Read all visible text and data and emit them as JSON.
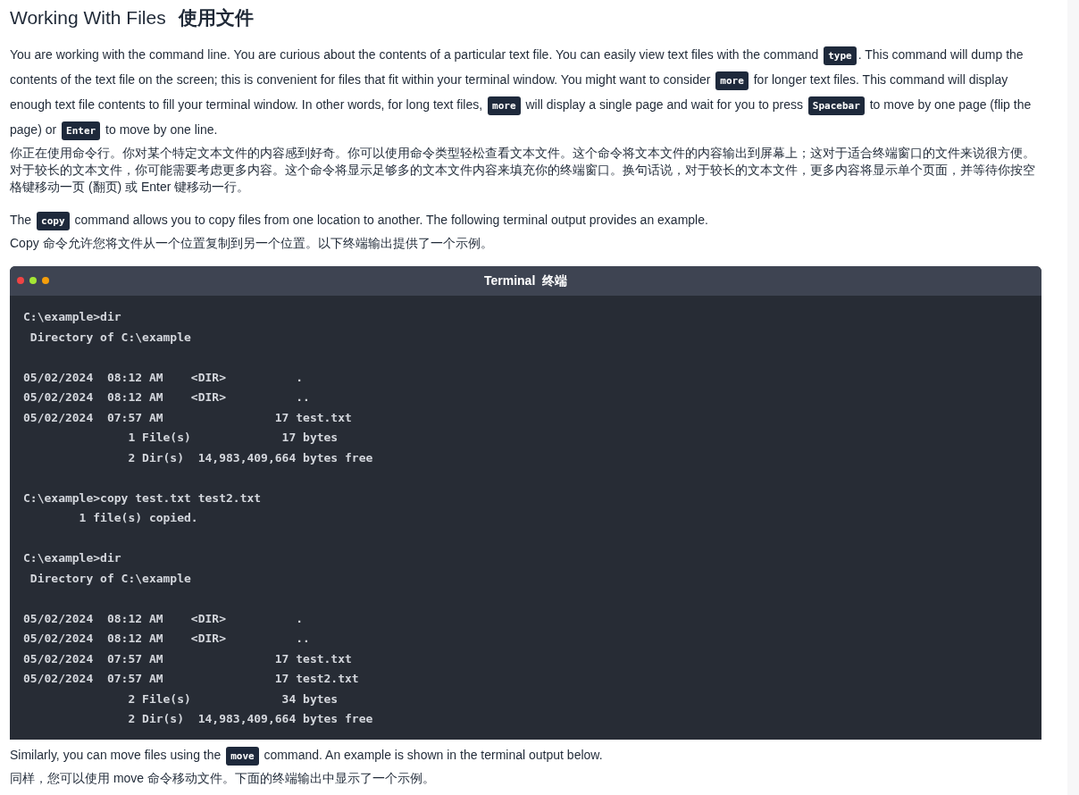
{
  "heading": {
    "english": "Working With Files",
    "chinese": "使用文件"
  },
  "sections": [
    {
      "english": [
        {
          "kind": "text",
          "text": "You are working with the command line. You are curious about the contents of a particular text file. You can easily view text files with the command "
        },
        {
          "kind": "code",
          "text": "type"
        },
        {
          "kind": "text",
          "text": ". This command will dump the contents of the text file on the screen; this is convenient for files that fit within your terminal window. You might want to consider "
        },
        {
          "kind": "code",
          "text": "more"
        },
        {
          "kind": "text",
          "text": " for longer text files. This command will display enough text file contents to fill your terminal window. In other words, for long text files, "
        },
        {
          "kind": "code",
          "text": "more"
        },
        {
          "kind": "text",
          "text": " will display a single page and wait for you to press "
        },
        {
          "kind": "code",
          "text": "Spacebar"
        },
        {
          "kind": "text",
          "text": " to move by one page (flip the page) or "
        },
        {
          "kind": "code",
          "text": "Enter"
        },
        {
          "kind": "text",
          "text": " to move by one line."
        }
      ],
      "chinese": "你正在使用命令行。你对某个特定文本文件的内容感到好奇。你可以使用命令类型轻松查看文本文件。这个命令将文本文件的内容输出到屏幕上；这对于适合终端窗口的文件来说很方便。对于较长的文本文件，你可能需要考虑更多内容。这个命令将显示足够多的文本文件内容来填充你的终端窗口。换句话说，对于较长的文本文件，更多内容将显示单个页面，并等待你按空格键移动一页 (翻页) 或 Enter 键移动一行。"
    },
    {
      "english": [
        {
          "kind": "text",
          "text": "The "
        },
        {
          "kind": "code",
          "text": "copy"
        },
        {
          "kind": "text",
          "text": " command allows you to copy files from one location to another. The following terminal output provides an example."
        }
      ],
      "chinese": "Copy 命令允许您将文件从一个位置复制到另一个位置。以下终端输出提供了一个示例。",
      "terminal": {
        "title": "Terminal  终端",
        "blocks": [
          [
            "C:\\example>dir",
            " Directory of C:\\example"
          ],
          [
            "05/02/2024  08:12 AM    <DIR>          .",
            "05/02/2024  08:12 AM    <DIR>          ..",
            "05/02/2024  07:57 AM                17 test.txt",
            "               1 File(s)             17 bytes",
            "               2 Dir(s)  14,983,409,664 bytes free"
          ],
          [
            "C:\\example>copy test.txt test2.txt",
            "        1 file(s) copied."
          ],
          [
            "C:\\example>dir",
            " Directory of C:\\example"
          ],
          [
            "05/02/2024  08:12 AM    <DIR>          .",
            "05/02/2024  08:12 AM    <DIR>          ..",
            "05/02/2024  07:57 AM                17 test.txt",
            "05/02/2024  07:57 AM                17 test2.txt",
            "               2 File(s)             34 bytes",
            "               2 Dir(s)  14,983,409,664 bytes free"
          ]
        ]
      }
    },
    {
      "english": [
        {
          "kind": "text",
          "text": "Similarly, you can move files using the "
        },
        {
          "kind": "code",
          "text": "move"
        },
        {
          "kind": "text",
          "text": " command. An example is shown in the terminal output below."
        }
      ],
      "chinese": "同样，您可以使用 move 命令移动文件。下面的终端输出中显示了一个示例。"
    }
  ]
}
